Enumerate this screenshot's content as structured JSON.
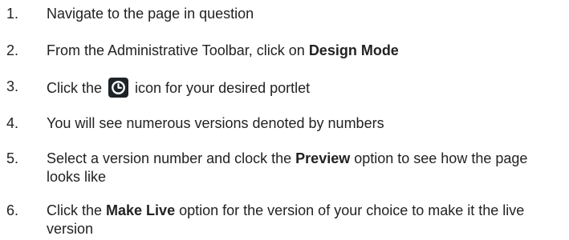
{
  "steps": [
    {
      "number": "1.",
      "text": "Navigate to the page in question"
    },
    {
      "number": "2.",
      "before": "From the Administrative Toolbar, click on ",
      "bold": "Design Mode",
      "after": ""
    },
    {
      "number": "3.",
      "before": "Click the ",
      "icon": "clock-history-icon",
      "after": " icon for your desired portlet"
    },
    {
      "number": "4.",
      "text": "You will see numerous versions denoted by numbers"
    },
    {
      "number": "5.",
      "before": "Select a version number and clock the ",
      "bold": "Preview",
      "after": " option to see how the page looks like"
    },
    {
      "number": "6.",
      "before": "Click the ",
      "bold": "Make Live",
      "after": " option for the version of your choice to make it the live version"
    }
  ]
}
